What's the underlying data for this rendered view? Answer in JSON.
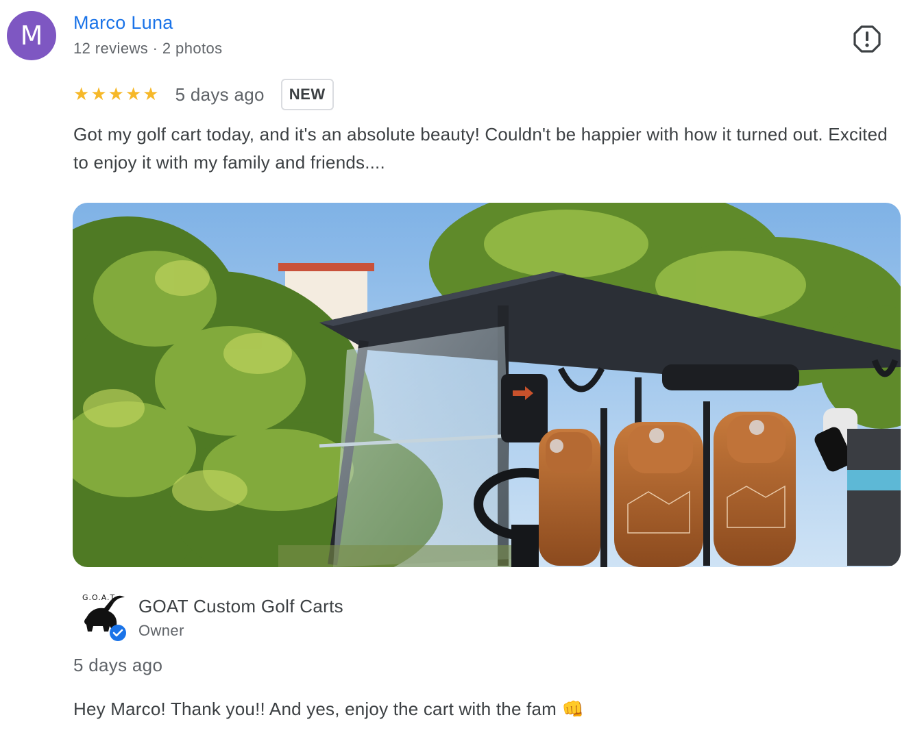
{
  "reviewer": {
    "avatar_letter": "M",
    "avatar_color": "#7e57c2",
    "name": "Marco Luna",
    "meta": "12 reviews · 2 photos"
  },
  "review": {
    "rating": 5,
    "rating_max": 5,
    "date": "5 days ago",
    "badge": "NEW",
    "text": "Got my golf cart today, and it's an absolute beauty! Couldn't be happier with how it turned out. Excited to enjoy it with my family and friends...."
  },
  "report": {
    "icon": "report-flag-icon"
  },
  "photo": {
    "subject": "golf-cart-photo"
  },
  "owner_response": {
    "name": "GOAT Custom Golf Carts",
    "role": "Owner",
    "logo_text": "G.O.A.T",
    "date": "5 days ago",
    "text": "Hey Marco! Thank you!! And yes, enjoy the cart with the fam",
    "emoji": "👊"
  },
  "colors": {
    "accent": "#1a73e8",
    "star": "#f6b829",
    "verified": "#1a73e8"
  }
}
